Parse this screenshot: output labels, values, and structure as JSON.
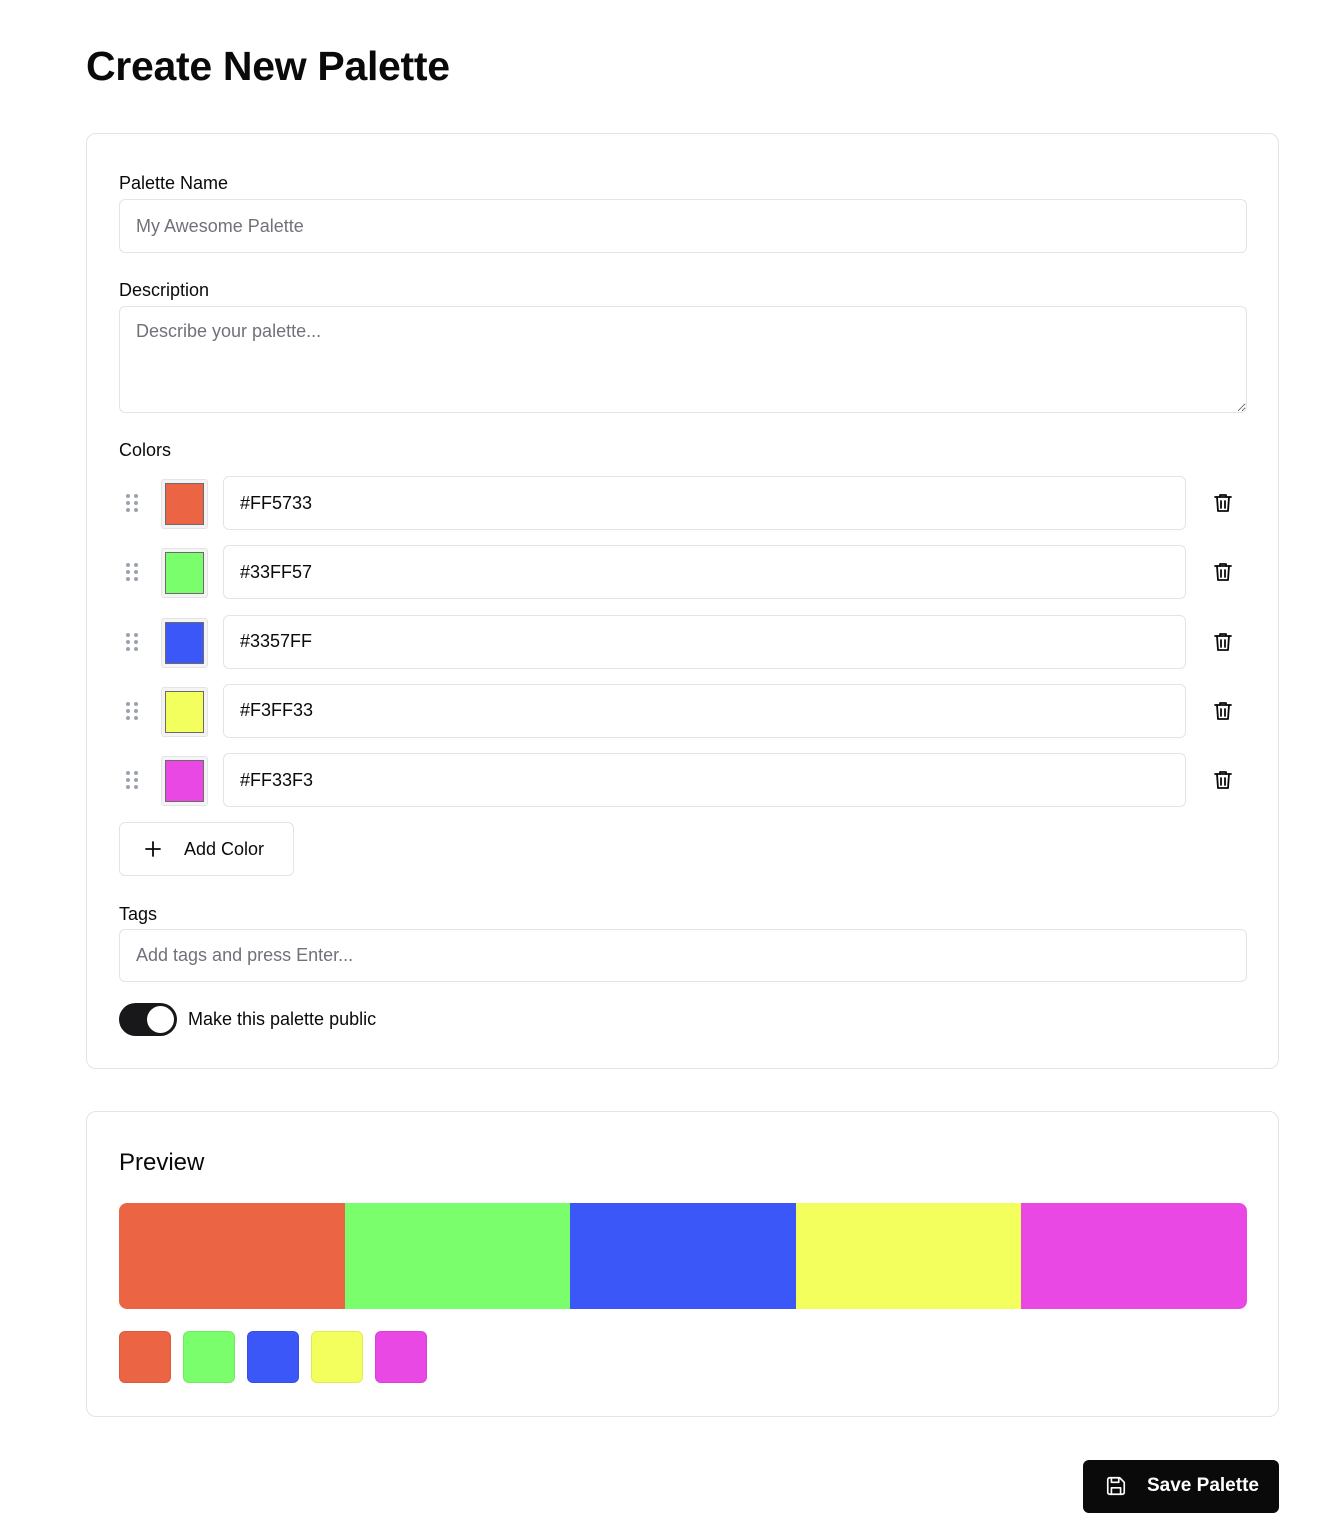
{
  "page": {
    "title": "Create New Palette"
  },
  "form": {
    "name_label": "Palette Name",
    "name_placeholder": "My Awesome Palette",
    "name_value": "",
    "description_label": "Description",
    "description_placeholder": "Describe your palette...",
    "description_value": "",
    "colors_label": "Colors",
    "colors": [
      {
        "hex": "#FF5733",
        "swatch": "#EB6443"
      },
      {
        "hex": "#33FF57",
        "swatch": "#7BFE6C"
      },
      {
        "hex": "#3357FF",
        "swatch": "#3B57F8"
      },
      {
        "hex": "#F3FF33",
        "swatch": "#F3FF5C"
      },
      {
        "hex": "#FF33F3",
        "swatch": "#E948E5"
      }
    ],
    "add_color_label": "Add Color",
    "tags_label": "Tags",
    "tags_placeholder": "Add tags and press Enter...",
    "tags_value": "",
    "public_toggle": {
      "label": "Make this palette public",
      "on": true
    }
  },
  "preview": {
    "title": "Preview"
  },
  "actions": {
    "save_label": "Save Palette"
  },
  "icons": {
    "drag": "grip-vertical-icon",
    "delete": "trash-icon",
    "add": "plus-icon",
    "save": "floppy-disk-icon"
  }
}
